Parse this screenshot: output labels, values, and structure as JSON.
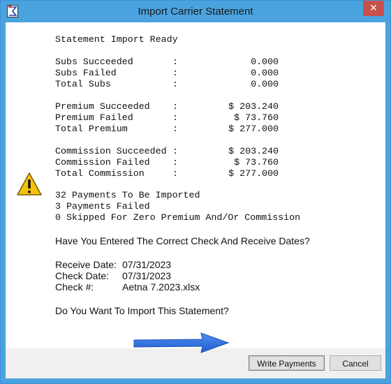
{
  "window": {
    "title": "Import Carrier Statement",
    "close_glyph": "✕",
    "app_icon": "sigma-app-icon"
  },
  "report": {
    "heading": "Statement Import Ready",
    "rows": [
      {
        "label": "Subs Succeeded",
        "colon": ":",
        "value": "0.000"
      },
      {
        "label": "Subs Failed",
        "colon": ":",
        "value": "0.000"
      },
      {
        "label": "Total Subs",
        "colon": ":",
        "value": "0.000"
      },
      {
        "label": "Premium Succeeded",
        "colon": ":",
        "value": "$ 203.240"
      },
      {
        "label": "Premium Failed",
        "colon": ":",
        "value": "$ 73.760"
      },
      {
        "label": "Total Premium",
        "colon": ":",
        "value": "$ 277.000"
      },
      {
        "label": "Commission Succeeded",
        "colon": ":",
        "value": "$ 203.240"
      },
      {
        "label": "Commission Failed",
        "colon": ":",
        "value": "$ 73.760"
      },
      {
        "label": "Total Commission",
        "colon": ":",
        "value": "$ 277.000"
      }
    ],
    "summary": [
      "32 Payments To Be Imported",
      "3 Payments Failed",
      "0 Skipped For Zero Premium And/Or Commission"
    ]
  },
  "question_dates": "Have You Entered The Correct Check And Receive Dates?",
  "details": {
    "receive_label": "Receive Date:",
    "receive_value": "07/31/2023",
    "check_label": "Check Date:",
    "check_value": "07/31/2023",
    "checknum_label": "Check #:",
    "checknum_value": "Aetna 7.2023.xlsx"
  },
  "question_import": "Do You Want To Import This Statement?",
  "buttons": {
    "write_payments": "Write Payments",
    "cancel": "Cancel"
  },
  "icons": {
    "warning": "warning-icon",
    "arrow": "blue-arrow-annotation"
  },
  "colors": {
    "titlebar": "#4aa3df",
    "close": "#c7504a",
    "arrow": "#2f6fd6",
    "warning_fill": "#f4c20d"
  }
}
